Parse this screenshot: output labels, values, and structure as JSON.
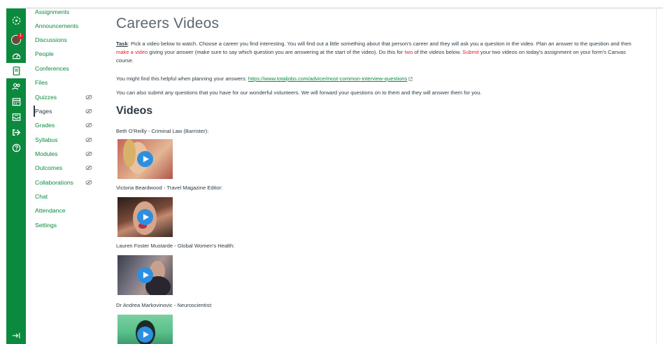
{
  "course_nav": {
    "items": [
      {
        "label": "Assignments",
        "hidden": false,
        "active": false
      },
      {
        "label": "Announcements",
        "hidden": false,
        "active": false
      },
      {
        "label": "Discussions",
        "hidden": false,
        "active": false
      },
      {
        "label": "People",
        "hidden": false,
        "active": false
      },
      {
        "label": "Conferences",
        "hidden": false,
        "active": false
      },
      {
        "label": "Files",
        "hidden": false,
        "active": false
      },
      {
        "label": "Quizzes",
        "hidden": true,
        "active": false
      },
      {
        "label": "Pages",
        "hidden": true,
        "active": true
      },
      {
        "label": "Grades",
        "hidden": true,
        "active": false
      },
      {
        "label": "Syllabus",
        "hidden": true,
        "active": false
      },
      {
        "label": "Modules",
        "hidden": true,
        "active": false
      },
      {
        "label": "Outcomes",
        "hidden": true,
        "active": false
      },
      {
        "label": "Collaborations",
        "hidden": true,
        "active": false
      },
      {
        "label": "Chat",
        "hidden": false,
        "active": false
      },
      {
        "label": "Attendance",
        "hidden": false,
        "active": false
      },
      {
        "label": "Settings",
        "hidden": false,
        "active": false
      }
    ]
  },
  "global_nav": {
    "icons": [
      "logo-icon",
      "account-avatar",
      "dashboard-icon",
      "courses-icon",
      "groups-icon",
      "calendar-icon",
      "inbox-icon",
      "commons-icon",
      "help-icon"
    ],
    "notification_count": "1"
  },
  "page": {
    "title": "Careers Videos",
    "task_label": "Task",
    "task_text_1": ": Pick a video below to watch. Choose a career you find interesting. You will find out a little something about that person's career and they will ask you a question in the video. Plan an answer to the question and then ",
    "task_link_make_video": "make a video",
    "task_text_2": " giving your answer (make sure to say which question you are answering at the start of the video). Do this for ",
    "task_two": "two",
    "task_text_3": " of the videos below. ",
    "task_submit": "Submit",
    "task_text_4": " your two videos on today's assignment on your form's Canvas course.",
    "helpful_text": "You might find this helpful when planning your answers: ",
    "helpful_link": "https://www.totaljobs.com/advice/most-common-interview-questions",
    "questions_text": "You can also submit any questions that you have for our wonderful volunteers. We will forward your questions on to them and they will answer them for you.",
    "videos_heading": "Videos",
    "videos": [
      {
        "caption": "Beth O'Reilly - Criminal Law (Barrister):"
      },
      {
        "caption": "Victoria Beardwood - Travel Magazine Editor:"
      },
      {
        "caption": "Lauren Foster Mustarde - Global Women's Health:"
      },
      {
        "caption": "Dr Andrea Markovinovic - Neuroscientist:"
      }
    ]
  },
  "colors": {
    "brand_green": "#0b8a3e",
    "accent_red": "#e0202e",
    "play_blue": "#2d8fe0",
    "text_dark": "#2d3b45"
  }
}
